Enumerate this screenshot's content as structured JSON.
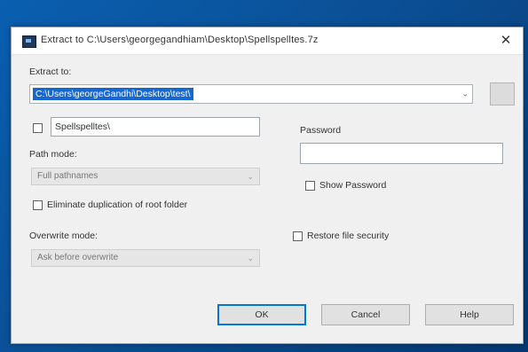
{
  "dialog": {
    "title": "Extract to C:\\Users\\georgegandhiam\\Desktop\\Spellspelltes.7z",
    "close_glyph": "✕"
  },
  "extract_to": {
    "label": "Extract to:",
    "value": "C:\\Users\\georgeGandhi\\Desktop\\test\\",
    "arrow_glyph": "⌄"
  },
  "subfolder": {
    "checked": false,
    "value": "Spellspelltes\\"
  },
  "path_mode": {
    "label": "Path mode:",
    "value": "Full pathnames",
    "arrow_glyph": "⌄"
  },
  "eliminate_dup": {
    "label": "Eliminate duplication of root folder",
    "checked": false
  },
  "overwrite_mode": {
    "label": "Overwrite mode:",
    "value": "Ask before overwrite",
    "arrow_glyph": "⌄"
  },
  "password": {
    "label": "Password",
    "value": "",
    "show_label": "Show Password",
    "show_checked": false
  },
  "restore_security": {
    "label": "Restore file security",
    "checked": false
  },
  "buttons": {
    "ok": "OK",
    "cancel": "Cancel",
    "help": "Help"
  },
  "colors": {
    "selection": "#1668cf",
    "default_button_border": "#0078d7",
    "desktop": "#0b4f95"
  }
}
